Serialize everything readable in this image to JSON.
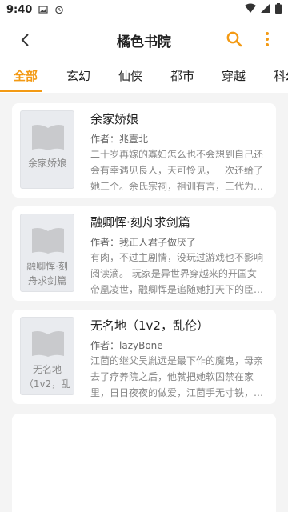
{
  "status_bar": {
    "time": "9:40"
  },
  "header": {
    "title": "橘色书院"
  },
  "tabs": [
    {
      "label": "全部"
    },
    {
      "label": "玄幻"
    },
    {
      "label": "仙侠"
    },
    {
      "label": "都市"
    },
    {
      "label": "穿越"
    },
    {
      "label": "科幻"
    }
  ],
  "books": [
    {
      "title": "余家娇娘",
      "cover_label": "余家娇娘",
      "author": "作者：兆壹北",
      "desc": "二十岁再嫁的寡妇怎么也不会想到自己还会有幸遇见良人，天可怜见，一次还给了她三个。余氏宗祠，祖训有言，三代为…"
    },
    {
      "title": "融卿恽·刻舟求剑篇",
      "cover_label": "融卿恽·刻舟求剑篇",
      "author": "作者：我正人君子做厌了",
      "desc": "有肉，不过主剧情，没玩过游戏也不影响阅读滴。 玩家是异世界穿越来的开国女帝凰凌世，融卿恽是追随她打天下的臣…"
    },
    {
      "title": "无名地（1v2，乱伦）",
      "cover_label": "无名地（1v2，乱",
      "author": "作者：lazyBone",
      "desc": "江茴的继父吴胤远是最下作的魔鬼，母亲去了疗养院之后，他就把她软囚禁在家里，日日夜夜的做爱，江茴手无寸铁，…"
    }
  ],
  "colors": {
    "accent": "#f39a14"
  }
}
